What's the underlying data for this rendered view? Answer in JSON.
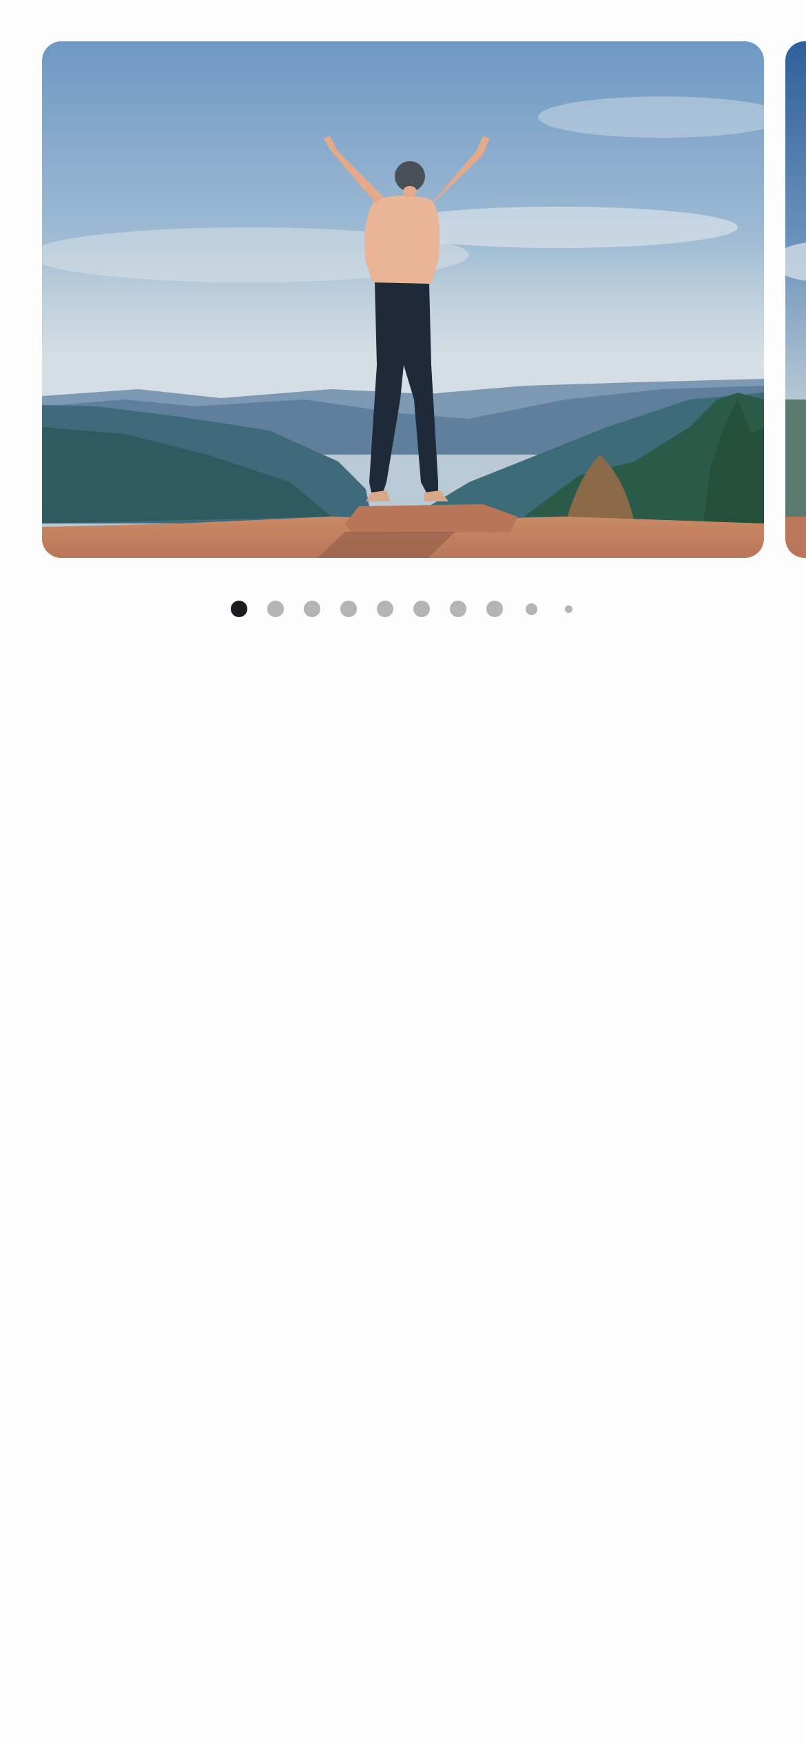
{
  "carousel": {
    "slides": [
      {
        "image": "person-on-mountain-cliff-arms-raised",
        "active": true
      },
      {
        "image": "mountain-landscape-partial",
        "active": false
      }
    ]
  },
  "pager": {
    "count": 10,
    "active_index": 0,
    "colors": {
      "active": "#1b1c1e",
      "inactive": "#b4b4b4"
    }
  }
}
